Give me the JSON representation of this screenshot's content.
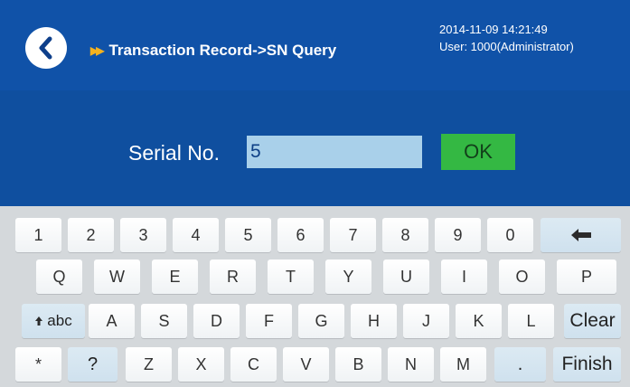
{
  "header": {
    "breadcrumb": "Transaction Record->SN Query",
    "datetime": "2014-11-09 14:21:49",
    "user": "User: 1000(Administrator)"
  },
  "form": {
    "serial_label": "Serial No.",
    "serial_value": "5",
    "ok_label": "OK"
  },
  "keyboard": {
    "row1": [
      "1",
      "2",
      "3",
      "4",
      "5",
      "6",
      "7",
      "8",
      "9",
      "0"
    ],
    "row2": [
      "Q",
      "W",
      "E",
      "R",
      "T",
      "Y",
      "U",
      "I",
      "O",
      "P"
    ],
    "shift_label": "abc",
    "row3": [
      "A",
      "S",
      "D",
      "F",
      "G",
      "H",
      "J",
      "K",
      "L"
    ],
    "clear_label": "Clear",
    "row4": [
      "*",
      "?",
      "Z",
      "X",
      "C",
      "V",
      "B",
      "N",
      "M",
      "."
    ],
    "finish_label": "Finish"
  },
  "colors": {
    "background": "#0e4ea0",
    "ok_button": "#34b843",
    "input_bg": "#a9d0ea",
    "breadcrumb_arrows": "#f5b21e"
  },
  "icons": [
    "back-arrow-icon",
    "breadcrumb-arrows-icon",
    "backspace-icon",
    "shift-arrow-icon"
  ]
}
